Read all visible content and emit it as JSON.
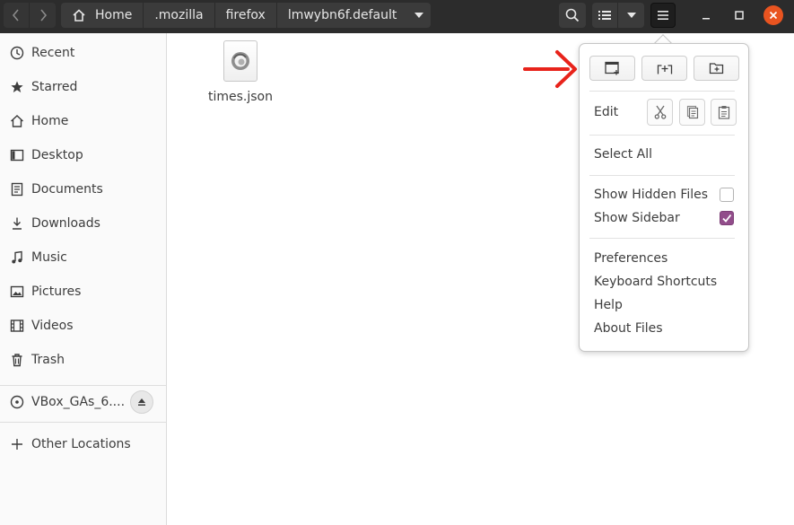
{
  "toolbar": {
    "back_icon": "chevron-left-icon",
    "forward_icon": "chevron-right-icon",
    "search_icon": "search-icon",
    "list_view_icon": "list-view-icon",
    "view_options_icon": "chevron-down-icon",
    "menu_icon": "hamburger-menu-icon"
  },
  "breadcrumbs": [
    {
      "label": "Home",
      "icon": "home-icon"
    },
    {
      "label": ".mozilla"
    },
    {
      "label": "firefox"
    },
    {
      "label": "lmwybn6f.default",
      "icon": "chevron-down-icon"
    }
  ],
  "window_controls": {
    "minimize_icon": "minimize-icon",
    "maximize_icon": "maximize-icon",
    "close_icon": "close-icon",
    "close_color": "#e95420"
  },
  "sidebar": {
    "items": [
      {
        "label": "Recent",
        "icon": "clock-icon"
      },
      {
        "label": "Starred",
        "icon": "star-icon"
      },
      {
        "label": "Home",
        "icon": "home-icon"
      },
      {
        "label": "Desktop",
        "icon": "desktop-icon"
      },
      {
        "label": "Documents",
        "icon": "document-icon"
      },
      {
        "label": "Downloads",
        "icon": "download-icon"
      },
      {
        "label": "Music",
        "icon": "music-icon"
      },
      {
        "label": "Pictures",
        "icon": "picture-icon"
      },
      {
        "label": "Videos",
        "icon": "video-icon"
      },
      {
        "label": "Trash",
        "icon": "trash-icon"
      }
    ],
    "device": {
      "label": "VBox_GAs_6....",
      "icon": "disc-icon",
      "eject_icon": "eject-icon"
    },
    "other_locations": {
      "label": "Other Locations",
      "icon": "plus-icon"
    }
  },
  "files": [
    {
      "name": "times.json",
      "icon": "json-file-icon"
    }
  ],
  "menu": {
    "top_buttons": [
      {
        "icon": "new-window-icon"
      },
      {
        "icon": "new-tab-icon"
      },
      {
        "icon": "new-folder-icon"
      }
    ],
    "edit_label": "Edit",
    "edit_buttons": [
      {
        "icon": "cut-icon"
      },
      {
        "icon": "copy-icon"
      },
      {
        "icon": "paste-icon"
      }
    ],
    "select_all": "Select All",
    "show_hidden_files": {
      "label": "Show Hidden Files",
      "checked": false
    },
    "show_sidebar": {
      "label": "Show Sidebar",
      "checked": true
    },
    "preferences": "Preferences",
    "keyboard_shortcuts": "Keyboard Shortcuts",
    "help": "Help",
    "about": "About Files"
  },
  "annotation": {
    "icon": "red-arrow-icon",
    "color": "#e8231b"
  },
  "colors": {
    "accent": "#924d8b",
    "header": "#2c2c2c"
  }
}
